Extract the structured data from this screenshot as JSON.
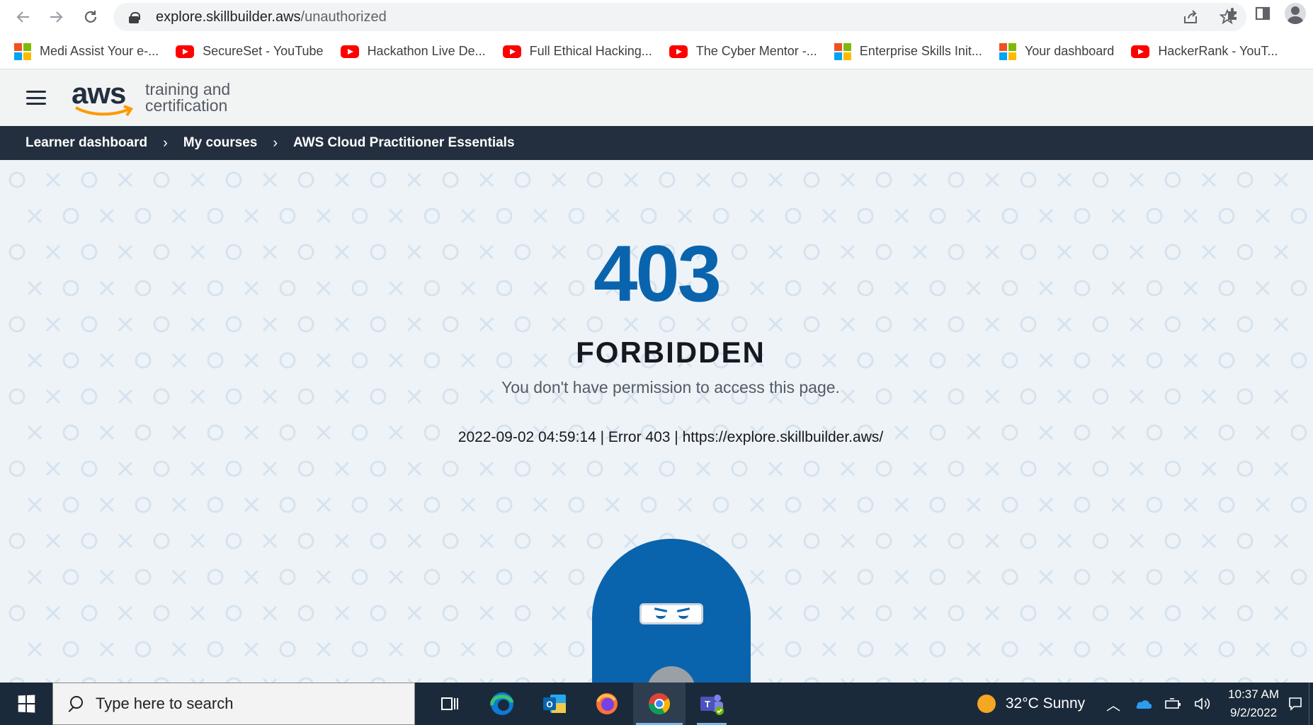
{
  "browser": {
    "url_host": "explore.skillbuilder.aws",
    "url_path": "/unauthorized",
    "back_icon": "arrow-left-icon",
    "forward_icon": "arrow-right-icon",
    "reload_icon": "reload-icon"
  },
  "bookmarks": [
    {
      "label": "Medi Assist Your e-...",
      "icon": "microsoft-icon"
    },
    {
      "label": "SecureSet - YouTube",
      "icon": "youtube-icon"
    },
    {
      "label": "Hackathon Live De...",
      "icon": "youtube-icon"
    },
    {
      "label": "Full Ethical Hacking...",
      "icon": "youtube-icon"
    },
    {
      "label": "The Cyber Mentor -...",
      "icon": "youtube-icon"
    },
    {
      "label": "Enterprise Skills Init...",
      "icon": "microsoft-icon"
    },
    {
      "label": "Your dashboard",
      "icon": "microsoft-icon"
    },
    {
      "label": "HackerRank - YouT...",
      "icon": "youtube-icon"
    }
  ],
  "header": {
    "logo_word": "aws",
    "logo_line1": "training and",
    "logo_line2": "certification"
  },
  "breadcrumb": [
    "Learner dashboard",
    "My courses",
    "AWS Cloud Practitioner Essentials"
  ],
  "error": {
    "code": "403",
    "title": "FORBIDDEN",
    "message": "You don't have permission to access this page.",
    "detail": "2022-09-02 04:59:14 | Error 403 | https://explore.skillbuilder.aws/"
  },
  "taskbar": {
    "search_placeholder": "Type here to search",
    "weather": "32°C  Sunny",
    "time": "10:37 AM",
    "date": "9/2/2022",
    "accent": "#0a64ad"
  }
}
